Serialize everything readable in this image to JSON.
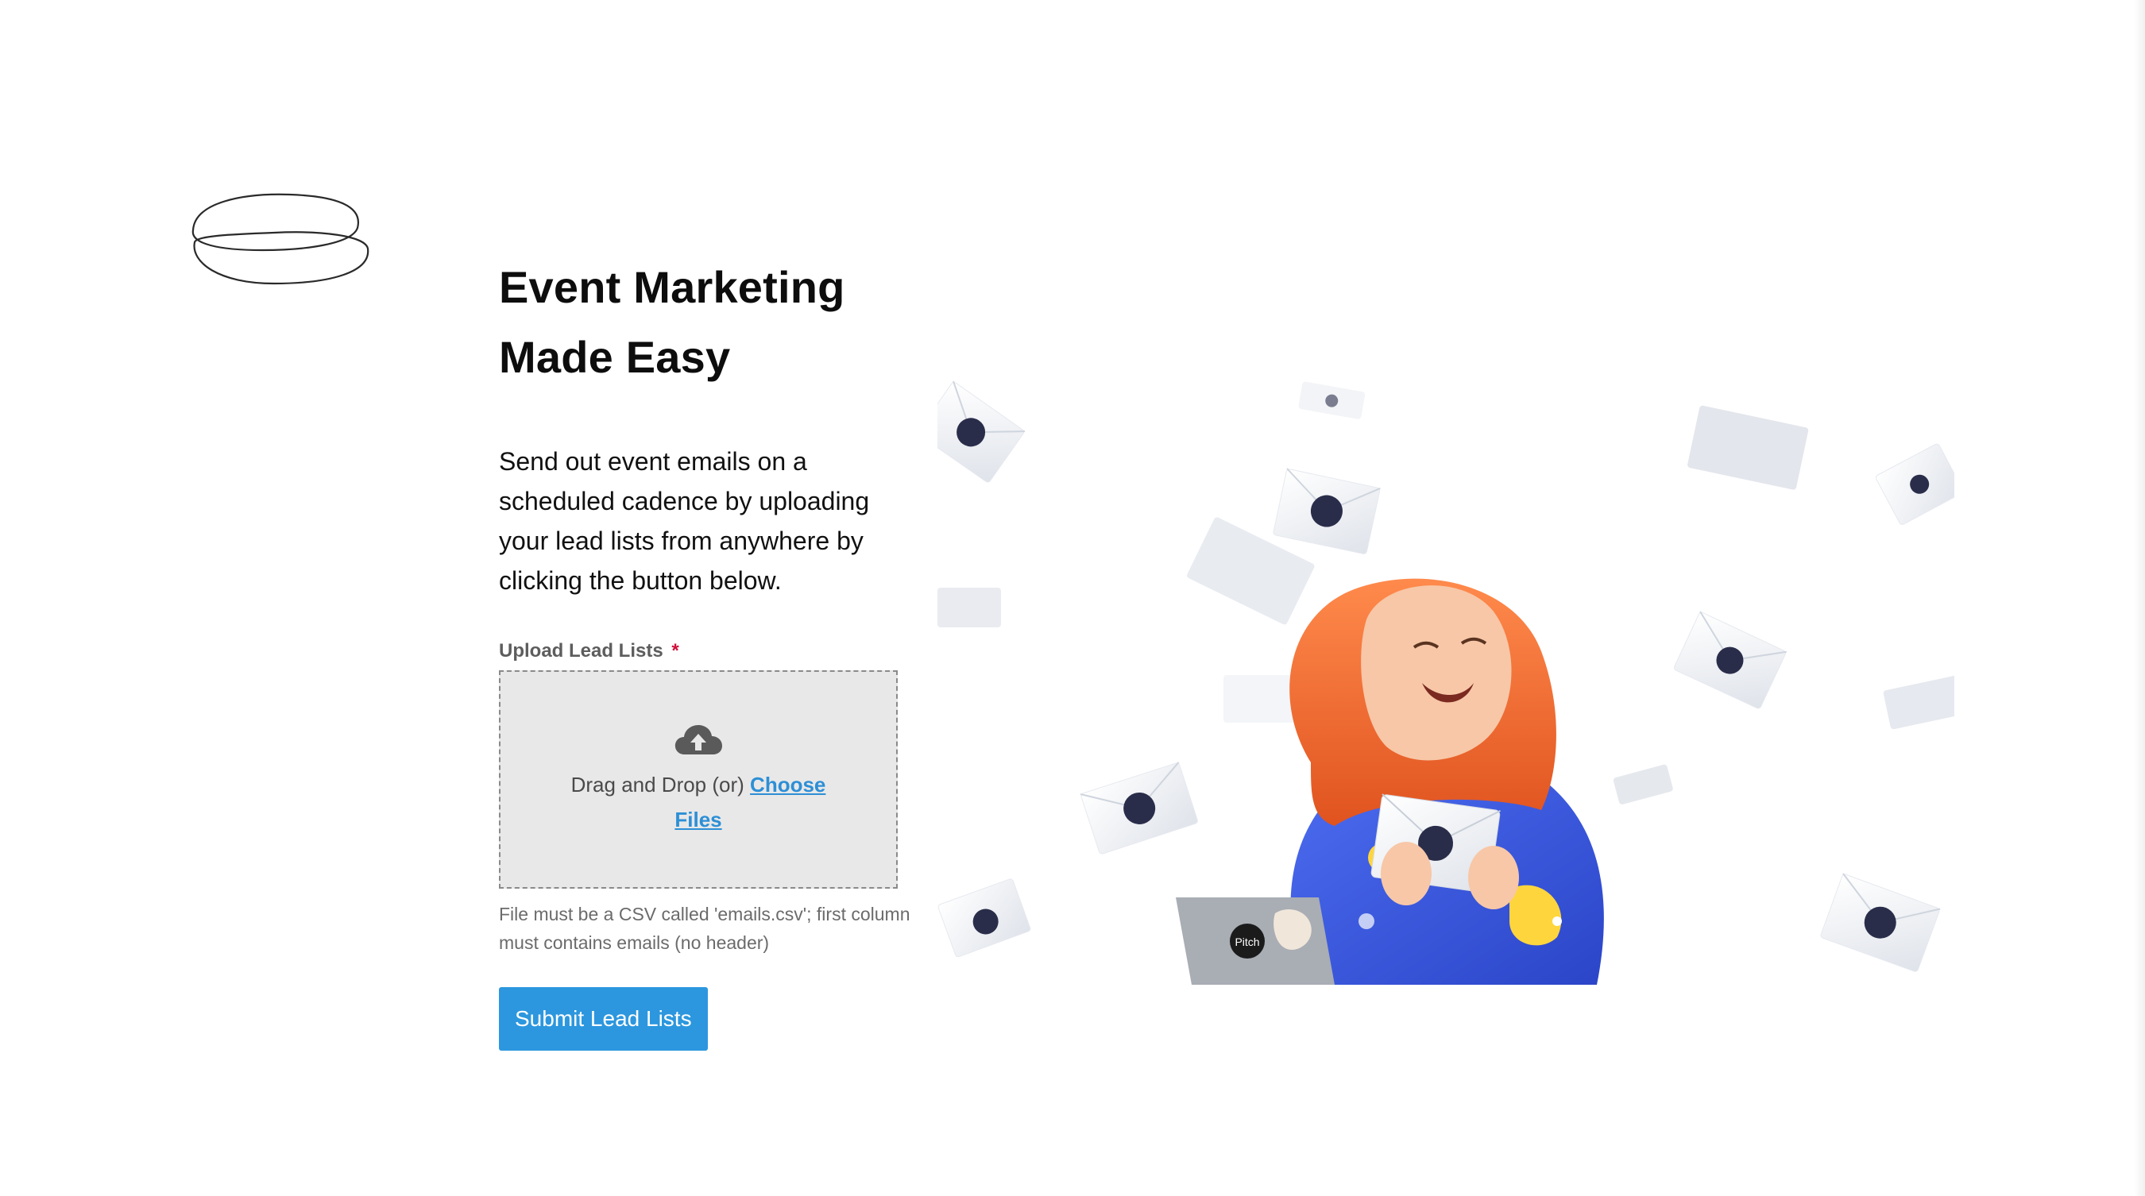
{
  "brand": {
    "logo_icon": "scribble-logo-icon"
  },
  "main": {
    "title_line1": "Event Marketing",
    "title_line2": "Made Easy",
    "description": "Send out event emails on a scheduled cadence by uploading your lead lists from anywhere by clicking the button below."
  },
  "upload": {
    "label": "Upload Lead Lists",
    "required_marker": "*",
    "icon": "cloud-upload-icon",
    "drop_text": "Drag and Drop (or)",
    "choose_link": "Choose Files",
    "help_text": "File must be a CSV called 'emails.csv'; first column must contains emails (no header)"
  },
  "actions": {
    "submit_label": "Submit Lead Lists"
  },
  "illustration": {
    "icon": "woman-with-envelopes-illustration",
    "laptop_sticker_text": "Pitch"
  },
  "colors": {
    "accent": "#2c97de",
    "link": "#2d8fd6",
    "required": "#d0103a",
    "dropzone_bg": "#e8e8e8",
    "hair": "#f26a2e",
    "sweater": "#3b5fe0"
  }
}
